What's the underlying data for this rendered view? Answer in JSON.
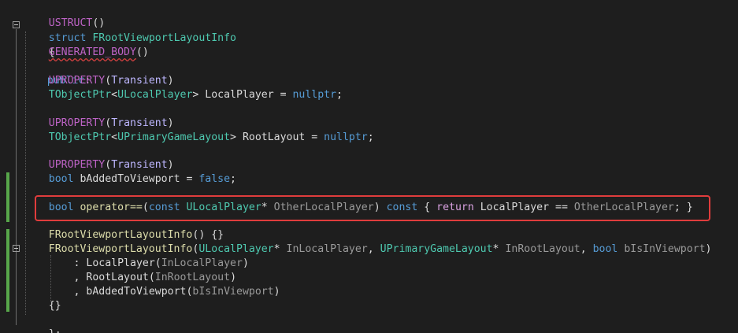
{
  "editor": {
    "language": "C++",
    "lines": {
      "l1": {
        "a": "USTRUCT",
        "b": "()"
      },
      "l2": {
        "kw": "struct",
        "name": "FRootViewportLayoutInfo"
      },
      "l3": {
        "brace": "{"
      },
      "l4": {
        "macro": "GENERATED_BODY",
        "rest": "()"
      },
      "l5": {
        "kw": "public",
        "rest": ":"
      },
      "l6": {
        "macro": "UPROPERTY",
        "open": "(",
        "arg": "Transient",
        "close": ")"
      },
      "l7": {
        "t1": "TObjectPtr",
        "lt": "<",
        "t2": "ULocalPlayer",
        "gt": ">",
        "name": " LocalPlayer",
        "eq": " = ",
        "val": "nullptr",
        "end": ";"
      },
      "l8": {
        "macro": "UPROPERTY",
        "open": "(",
        "arg": "Transient",
        "close": ")"
      },
      "l9": {
        "t1": "TObjectPtr",
        "lt": "<",
        "t2": "UPrimaryGameLayout",
        "gt": ">",
        "name": " RootLayout",
        "eq": " = ",
        "val": "nullptr",
        "end": ";"
      },
      "l10": {
        "macro": "UPROPERTY",
        "open": "(",
        "arg": "Transient",
        "close": ")"
      },
      "l11": {
        "kw": "bool",
        "name": " bAddedToViewport",
        "eq": " = ",
        "val": "false",
        "end": ";"
      },
      "l12": {
        "kw": "bool",
        "op": " operator==",
        "p1": "(",
        "c": "const",
        "sp": " ",
        "t": "ULocalPlayer",
        "star": "* ",
        "param": "OtherLocalPlayer",
        "p2": ") ",
        "c2": "const",
        "b1": " { ",
        "ret": "return",
        "sp2": " ",
        "m": "LocalPlayer",
        "eqeq": " == ",
        "param2": "OtherLocalPlayer",
        "b2": "; }"
      },
      "l13": {
        "fn": "FRootViewportLayoutInfo",
        "rest": "() {}"
      },
      "l14": {
        "fn": "FRootViewportLayoutInfo",
        "p1": "(",
        "t1": "ULocalPlayer",
        "s1": "* ",
        "a1": "InLocalPlayer",
        "c1": ", ",
        "t2": "UPrimaryGameLayout",
        "s2": "* ",
        "a2": "InRootLayout",
        "c2": ", ",
        "kw": "bool",
        "sp": " ",
        "a3": "bIsInViewport",
        "p2": ")"
      },
      "l15": {
        "lead": ": ",
        "m": "LocalPlayer",
        "o": "(",
        "a": "InLocalPlayer",
        "c": ")"
      },
      "l16": {
        "lead": ", ",
        "m": "RootLayout",
        "o": "(",
        "a": "InRootLayout",
        "c": ")"
      },
      "l17": {
        "lead": ", ",
        "m": "bAddedToViewport",
        "o": "(",
        "a": "bIsInViewport",
        "c": ")"
      },
      "l18": {
        "body": "{}"
      },
      "l19": {
        "end": "};"
      }
    },
    "colors": {
      "background": "#1e1e1e",
      "keyword": "#569cd6",
      "type": "#4ec9b0",
      "macro": "#beb7ff",
      "function": "#dcdcaa",
      "parameter": "#9a9a9a",
      "highlight_border": "#e03c3c",
      "change_bar": "#57a64a"
    }
  }
}
